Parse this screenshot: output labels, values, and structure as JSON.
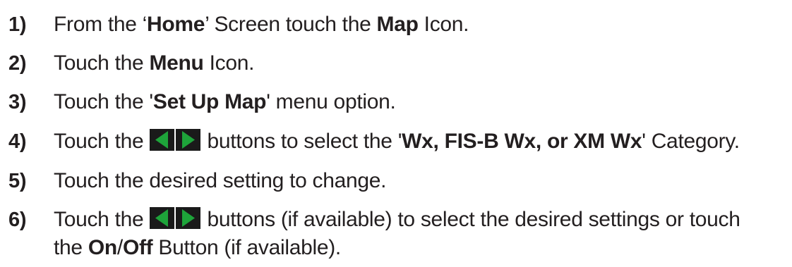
{
  "steps": [
    {
      "number": "1)",
      "parts": [
        "From the ‘",
        "Home",
        "’ Screen touch the ",
        "Map",
        " Icon."
      ]
    },
    {
      "number": "2)",
      "parts": [
        "Touch the ",
        "Menu",
        " Icon."
      ]
    },
    {
      "number": "3)",
      "parts": [
        "Touch the '",
        "Set Up Map",
        "' menu option."
      ]
    },
    {
      "number": "4)",
      "parts": [
        "Touch the ",
        " buttons to select the '",
        "Wx, FIS-B Wx, or XM Wx",
        "' Category."
      ]
    },
    {
      "number": "5)",
      "parts": [
        "Touch the desired setting to change."
      ]
    },
    {
      "number": "6)",
      "parts": [
        "Touch the ",
        " buttons (if available) to select the desired settings or touch"
      ],
      "line2": [
        "the ",
        "On",
        "/",
        "Off",
        " Button (if available)."
      ]
    }
  ],
  "colors": {
    "button_green": "#1ea43a",
    "button_dark": "#1a1a1a",
    "text": "#231f20"
  },
  "icons": {
    "left_right_buttons": "left-right-arrow-buttons-icon"
  }
}
